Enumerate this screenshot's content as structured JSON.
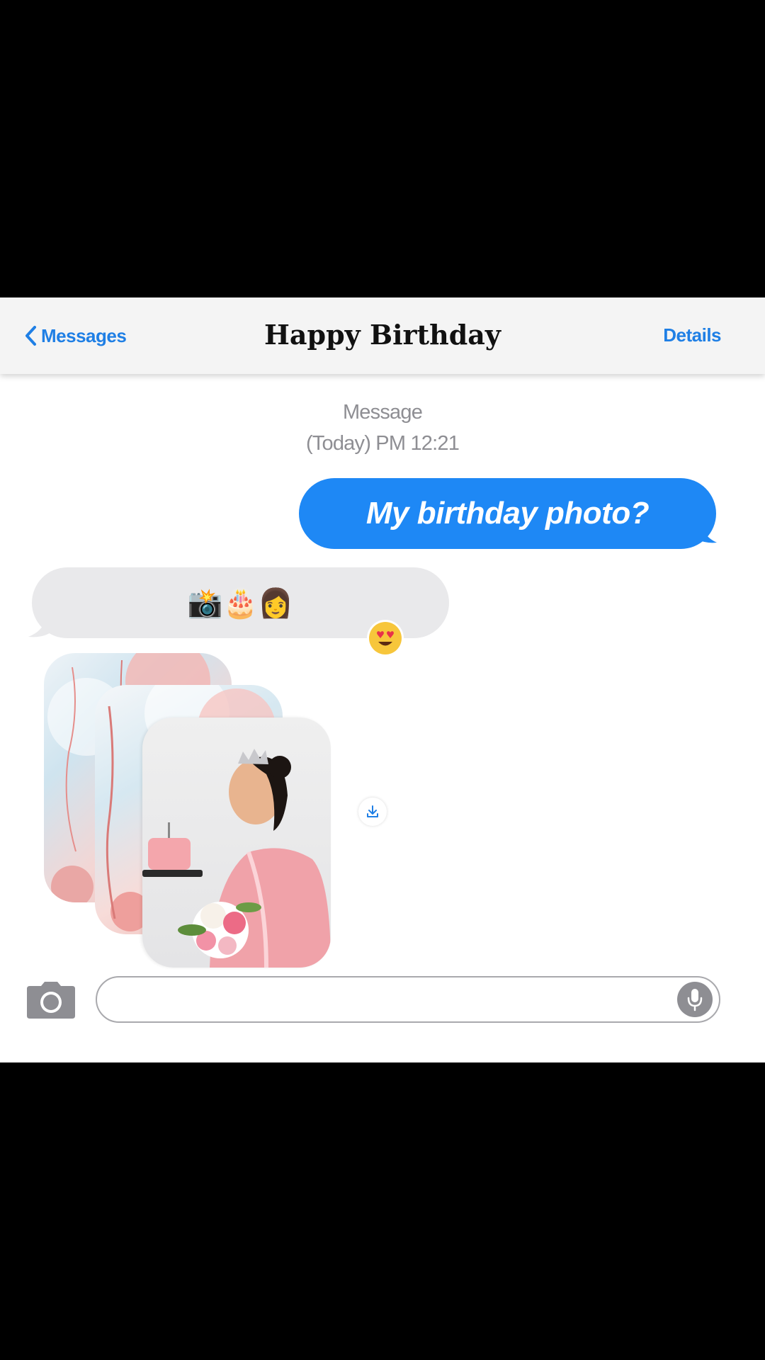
{
  "header": {
    "back_label": "Messages",
    "title": "Happy Birthday",
    "details_label": "Details"
  },
  "conversation": {
    "timestamp_line1": "Message",
    "timestamp_line2": "(Today) PM 12:21",
    "sent_message": "My birthday photo?",
    "received_message": "📸🎂👩",
    "reaction": "😍"
  },
  "input": {
    "placeholder": ""
  },
  "colors": {
    "accent": "#1f7fe5",
    "sent_bubble": "#1e88f5",
    "received_bubble": "#e9e9eb"
  },
  "icons": [
    "chevron-left-icon",
    "camera-icon",
    "microphone-icon",
    "download-icon",
    "heart-eyes-emoji"
  ]
}
